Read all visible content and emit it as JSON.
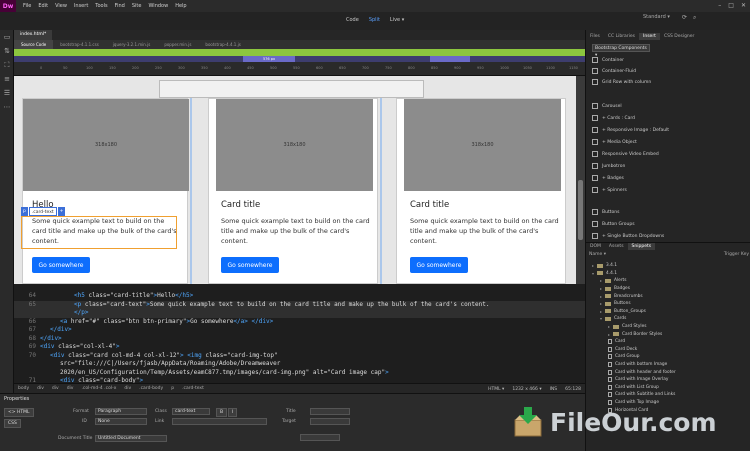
{
  "app": {
    "logo": "Dw"
  },
  "menubar": {
    "items": [
      "File",
      "Edit",
      "View",
      "Insert",
      "Tools",
      "Find",
      "Site",
      "Window",
      "Help"
    ]
  },
  "window_controls": {
    "minimize": "–",
    "maximize": "□",
    "close": "✕"
  },
  "view_switch": {
    "code": "Code",
    "split": "Split",
    "live": "Live ▾"
  },
  "workspace": {
    "label": "Standard ▾"
  },
  "document_tab": "index.html*",
  "related_files": [
    "Source Code",
    "bootstrap-4.1.1.css",
    "jquery-3.2.1.min.js",
    "popper.min.js",
    "bootstrap-4.4.1.js"
  ],
  "media_query": {
    "pill1": "576 px",
    "pill2": ""
  },
  "ruler_ticks": [
    "0",
    "50",
    "100",
    "150",
    "200",
    "250",
    "300",
    "350",
    "400",
    "450",
    "500",
    "550",
    "600",
    "650",
    "700",
    "750",
    "800",
    "850",
    "900",
    "950",
    "1000",
    "1050",
    "1100",
    "1150"
  ],
  "design": {
    "img_placeholder": "318x180",
    "cards": [
      {
        "title": "Hello",
        "text": "Some quick example text to build on the card title and make up the bulk of the card's content.",
        "button": "Go somewhere"
      },
      {
        "title": "Card title",
        "text": "Some quick example text to build on the card title and make up the bulk of the card's content.",
        "button": "Go somewhere"
      },
      {
        "title": "Card title",
        "text": "Some quick example text to build on the card title and make up the bulk of the card's content.",
        "button": "Go somewhere"
      }
    ],
    "selection_tag": {
      "tag": "p",
      "class": ".card-text",
      "plus": "+"
    }
  },
  "code": {
    "lines": [
      {
        "num": "64",
        "html": "<span class='tag'>&lt;h5</span> class=\"card-title\"<span class='tag'>&gt;</span>Hello<span class='tag'>&lt;/h5&gt;</span>"
      },
      {
        "num": "65",
        "html": "<span class='tag'>&lt;p</span> class=\"card-text\"<span class='tag'>&gt;</span>Some quick example text to build on the card title and make up the bulk of the card's content."
      },
      {
        "num": "",
        "html": "<span class='tag'>&lt;/p&gt;</span>"
      },
      {
        "num": "66",
        "html": "<span class='tag'>&lt;a</span> href=\"#\" class=\"btn btn-primary\"<span class='tag'>&gt;</span>Go somewhere<span class='tag'>&lt;/a&gt;</span> <span class='tag'>&lt;/div&gt;</span>"
      },
      {
        "num": "67",
        "html": "<span class='tag'>&lt;/div&gt;</span>"
      },
      {
        "num": "68",
        "html": "<span class='tag'>&lt;/div&gt;</span>"
      },
      {
        "num": "69",
        "html": "<span class='tag'>&lt;div</span> class=\"col-xl-4\"<span class='tag'>&gt;</span>"
      },
      {
        "num": "70",
        "html": "<span class='tag'>&lt;div</span> class=\"card col-md-4 col-xl-12\"<span class='tag'>&gt;</span> <span class='tag'>&lt;img</span> class=\"card-img-top\""
      },
      {
        "num": "",
        "html": "src=\"file:///C|/Users/fjasb/AppData/Roaming/Adobe/Dreamweaver"
      },
      {
        "num": "",
        "html": "2020/en_US/Configuration/Temp/Assets/eamC877.tmp/images/card-img.png\" alt=\"Card image cap\"<span class='tag'>&gt;</span>"
      },
      {
        "num": "71",
        "html": "<span class='tag'>&lt;div</span> class=\"card-body\"<span class='tag'>&gt;</span>"
      }
    ]
  },
  "tagbar": {
    "crumbs": [
      "body",
      "div",
      "div",
      "div",
      ".col-md-4 .col-x",
      "div",
      ".card-body",
      "p",
      ".card-text"
    ],
    "lang": "HTML ▾",
    "size": "1232 x 466 ▾",
    "mode": "INS",
    "position": "65:128"
  },
  "properties": {
    "title": "Properties",
    "html_btn": "<> HTML",
    "css_btn": "CSS",
    "format_label": "Format",
    "format_value": "Paragraph",
    "class_label": "Class",
    "class_value": "card-text",
    "id_label": "ID",
    "id_value": "None",
    "link_label": "Link",
    "title_label": "Title",
    "target_label": "Target",
    "doc_title_label": "Document Title",
    "doc_title_value": "Untitled Document",
    "bold": "B",
    "italic": "I"
  },
  "right_panel": {
    "tabs": [
      "Files",
      "CC Libraries",
      "Insert",
      "CSS Designer"
    ],
    "dropdown": "Bootstrap Components ▾",
    "insert_items": [
      "Container",
      "Container-Fluid",
      "Grid Row with column",
      "Carousel",
      "+ Cards : Card",
      "+ Responsive Image : Default",
      "+ Media Object",
      "Responsive Video Embed",
      "Jumbotron",
      "+ Badges",
      "+ Spinners",
      "Buttons",
      "Button Groups",
      "+ Single Button Dropdowns"
    ],
    "tabs2": [
      "DOM",
      "Assets",
      "Snippets"
    ],
    "snip_head": {
      "name": "Name ▾",
      "trigger": "Trigger Key"
    },
    "snippets": [
      {
        "label": "3.4.1",
        "type": "folder",
        "level": 0
      },
      {
        "label": "4.4.1",
        "type": "folder",
        "level": 0
      },
      {
        "label": "Alerts",
        "type": "folder",
        "level": 1
      },
      {
        "label": "Badges",
        "type": "folder",
        "level": 1
      },
      {
        "label": "Breadcrumbs",
        "type": "folder",
        "level": 1
      },
      {
        "label": "Buttons",
        "type": "folder",
        "level": 1
      },
      {
        "label": "Button_Groups",
        "type": "folder",
        "level": 1
      },
      {
        "label": "Cards",
        "type": "folder",
        "level": 1
      },
      {
        "label": "Card Styles",
        "type": "folder",
        "level": 2
      },
      {
        "label": "Card Border Styles",
        "type": "folder",
        "level": 2
      },
      {
        "label": "Card",
        "type": "file",
        "level": 2
      },
      {
        "label": "Card Deck",
        "type": "file",
        "level": 2
      },
      {
        "label": "Card Group",
        "type": "file",
        "level": 2
      },
      {
        "label": "Card with bottom Image",
        "type": "file",
        "level": 2
      },
      {
        "label": "Card with header and footer",
        "type": "file",
        "level": 2
      },
      {
        "label": "Card with Image Overlay",
        "type": "file",
        "level": 2
      },
      {
        "label": "Card with List Group",
        "type": "file",
        "level": 2
      },
      {
        "label": "Card with Subtitle and Links",
        "type": "file",
        "level": 2
      },
      {
        "label": "Card with Top Image",
        "type": "file",
        "level": 2
      },
      {
        "label": "Horizontal Card",
        "type": "file",
        "level": 2
      }
    ]
  },
  "watermark": {
    "text": "FileOur.com"
  }
}
